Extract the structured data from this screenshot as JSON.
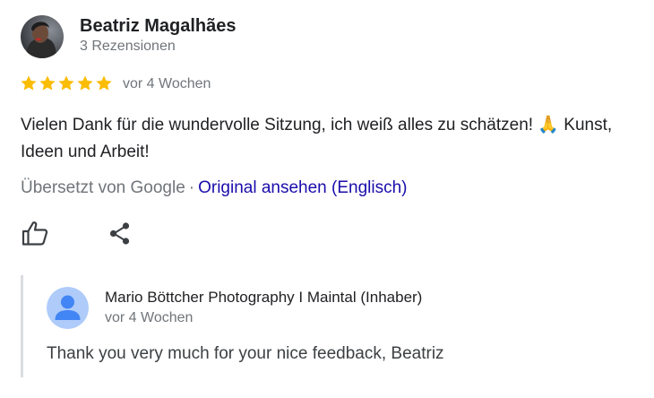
{
  "review": {
    "reviewer_name": "Beatriz Magalhães",
    "review_count": "3 Rezensionen",
    "rating": 5,
    "max_rating": 5,
    "time": "vor 4 Wochen",
    "text": "Vielen Dank für die wundervolle Sitzung, ich weiß alles zu schätzen! 🙏 Kunst, Ideen und Arbeit!",
    "translated_by": "Übersetzt von Google",
    "separator": "·",
    "view_original": "Original ansehen (Englisch)"
  },
  "actions": {
    "like_icon": "thumb-up-icon",
    "share_icon": "share-icon"
  },
  "owner_reply": {
    "owner_name": "Mario Böttcher Photography I Maintal (Inhaber)",
    "time": "vor 4 Wochen",
    "text": "Thank you very much for your nice feedback, Beatriz",
    "avatar_icon": "default-profile-icon"
  },
  "colors": {
    "star": "#fbbc04",
    "link": "#1a0dab",
    "secondary_text": "#70757a",
    "primary_text": "#202124",
    "reply_border": "#dadce0",
    "owner_avatar_bg": "#aecbfa",
    "owner_avatar_fg": "#4285f4"
  }
}
